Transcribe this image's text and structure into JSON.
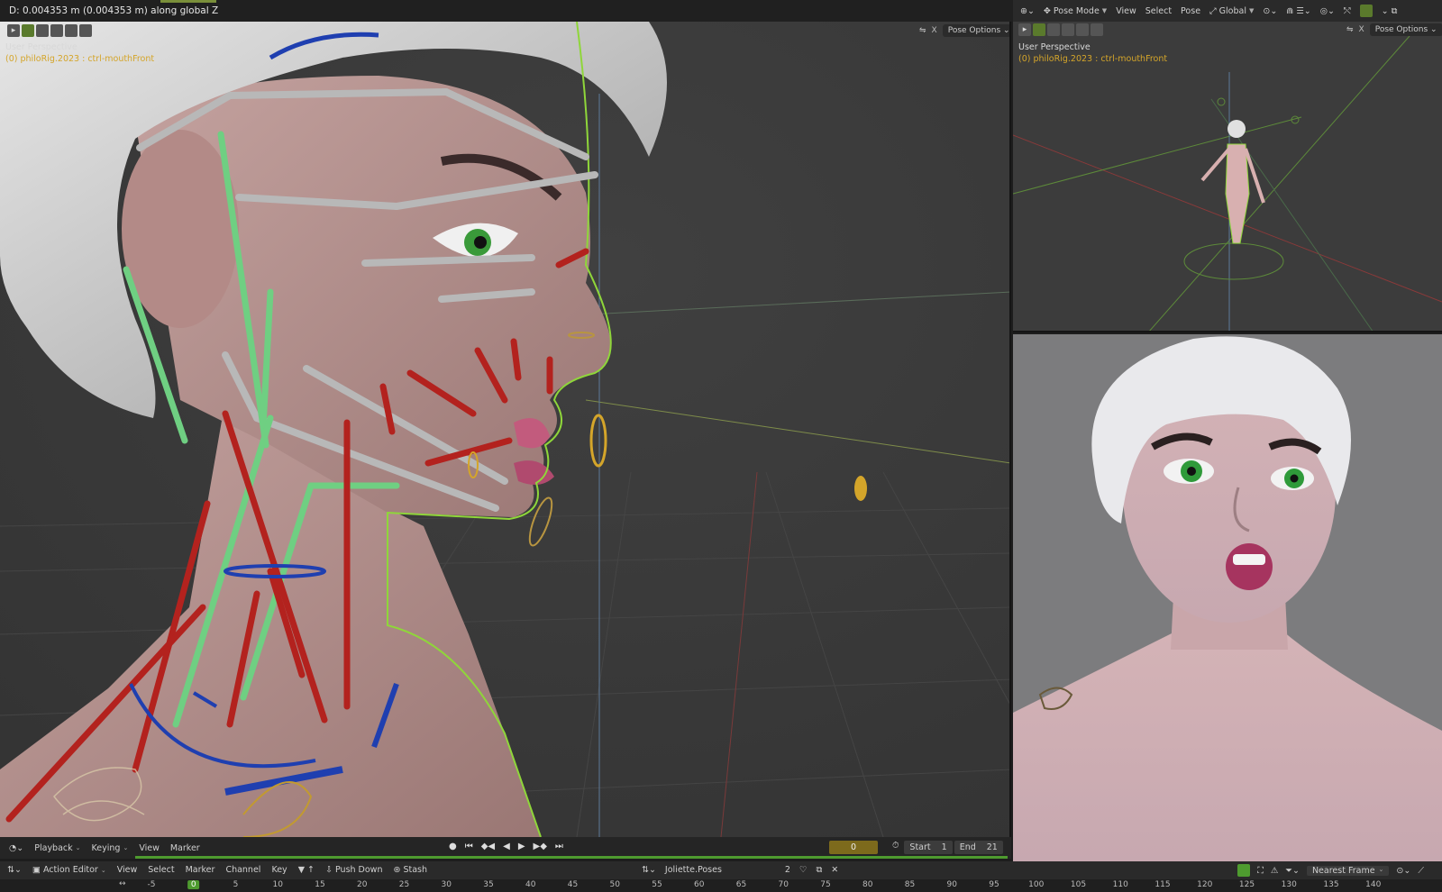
{
  "status_bar": {
    "text": "D: 0.004353 m (0.004353 m) along global Z"
  },
  "main_viewport": {
    "perspective": "User Perspective",
    "object_label": "(0) philoRig.2023 : ctrl-mouthFront",
    "pose_options": "Pose Options",
    "x_toggle": "X"
  },
  "top_right_viewport": {
    "mode": "Pose Mode",
    "menus": [
      "View",
      "Select",
      "Pose"
    ],
    "orientation": "Global",
    "perspective": "User Perspective",
    "object_label": "(0) philoRig.2023 : ctrl-mouthFront",
    "pose_options": "Pose Options",
    "x_toggle": "X"
  },
  "timeline": {
    "menus": {
      "playback": "Playback",
      "keying": "Keying",
      "view": "View",
      "marker": "Marker"
    },
    "transport_icons": [
      "record-icon",
      "jump-start-icon",
      "prev-keyframe-icon",
      "play-reverse-icon",
      "play-icon",
      "next-keyframe-icon",
      "jump-end-icon"
    ],
    "current_frame": "0",
    "start_label": "Start",
    "start_value": "1",
    "end_label": "End",
    "end_value": "21"
  },
  "action_editor": {
    "mode": "Action Editor",
    "menus": {
      "view": "View",
      "select": "Select",
      "marker": "Marker",
      "channel": "Channel",
      "key": "Key"
    },
    "push_down": "Push Down",
    "stash": "Stash",
    "action_name": "Joliette.Poses",
    "users": "2",
    "snapping": "Nearest Frame"
  },
  "frame_ruler": {
    "current": "0",
    "labels": [
      "-5",
      "0",
      "5",
      "10",
      "15",
      "20",
      "25",
      "30",
      "35",
      "40",
      "45",
      "50",
      "55",
      "60",
      "65",
      "70",
      "75",
      "80",
      "85",
      "90",
      "95",
      "100",
      "105",
      "110",
      "115",
      "120",
      "125",
      "130",
      "135",
      "140"
    ]
  },
  "colors": {
    "accent_green": "#4e9b2f",
    "object_label_yellow": "#d4a52a",
    "frame_box": "#7d6a1c",
    "bone_red": "#b3221e",
    "bone_green": "#6fcf82",
    "bone_grey": "#b8b8b8",
    "bone_blue": "#1f3fb0"
  }
}
